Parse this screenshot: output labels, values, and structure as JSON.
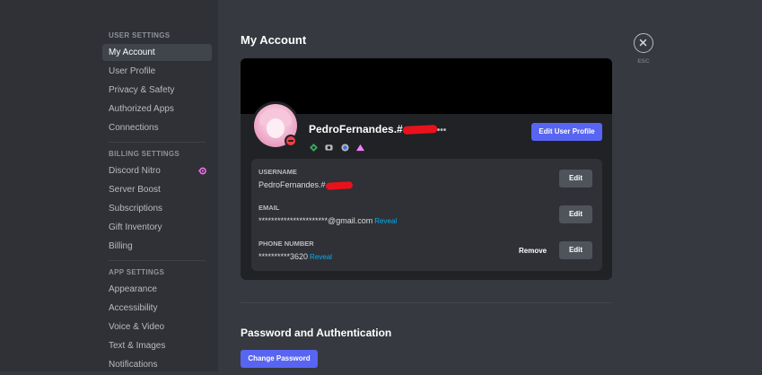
{
  "sidebar": {
    "user_settings_header": "USER SETTINGS",
    "user_items": [
      {
        "label": "My Account"
      },
      {
        "label": "User Profile"
      },
      {
        "label": "Privacy & Safety"
      },
      {
        "label": "Authorized Apps"
      },
      {
        "label": "Connections"
      }
    ],
    "billing_header": "BILLING SETTINGS",
    "billing_items": [
      {
        "label": "Discord Nitro"
      },
      {
        "label": "Server Boost"
      },
      {
        "label": "Subscriptions"
      },
      {
        "label": "Gift Inventory"
      },
      {
        "label": "Billing"
      }
    ],
    "app_header": "APP SETTINGS",
    "app_items": [
      {
        "label": "Appearance"
      },
      {
        "label": "Accessibility"
      },
      {
        "label": "Voice & Video"
      },
      {
        "label": "Text & Images"
      },
      {
        "label": "Notifications"
      }
    ]
  },
  "main": {
    "title": "My Account",
    "profile": {
      "username": "PedroFernandes.#",
      "dots": "•••",
      "edit_button": "Edit User Profile",
      "status": "do-not-disturb",
      "badges": [
        "hypesquad-icon",
        "nitro-icon",
        "boost-icon",
        "early-supporter-icon"
      ]
    },
    "fields": {
      "username": {
        "label": "USERNAME",
        "value": "PedroFernandes.#",
        "edit": "Edit"
      },
      "email": {
        "label": "EMAIL",
        "value": "**********************@gmail.com",
        "reveal": "Reveal",
        "edit": "Edit"
      },
      "phone": {
        "label": "PHONE NUMBER",
        "value": "**********3620",
        "reveal": "Reveal",
        "remove": "Remove",
        "edit": "Edit"
      }
    },
    "password_section": {
      "title": "Password and Authentication",
      "button": "Change Password"
    },
    "close": {
      "label": "ESC"
    }
  },
  "colors": {
    "accent": "#5865f2",
    "link": "#00aff4",
    "dnd": "#ed4245",
    "redaction": "#e8121d"
  }
}
